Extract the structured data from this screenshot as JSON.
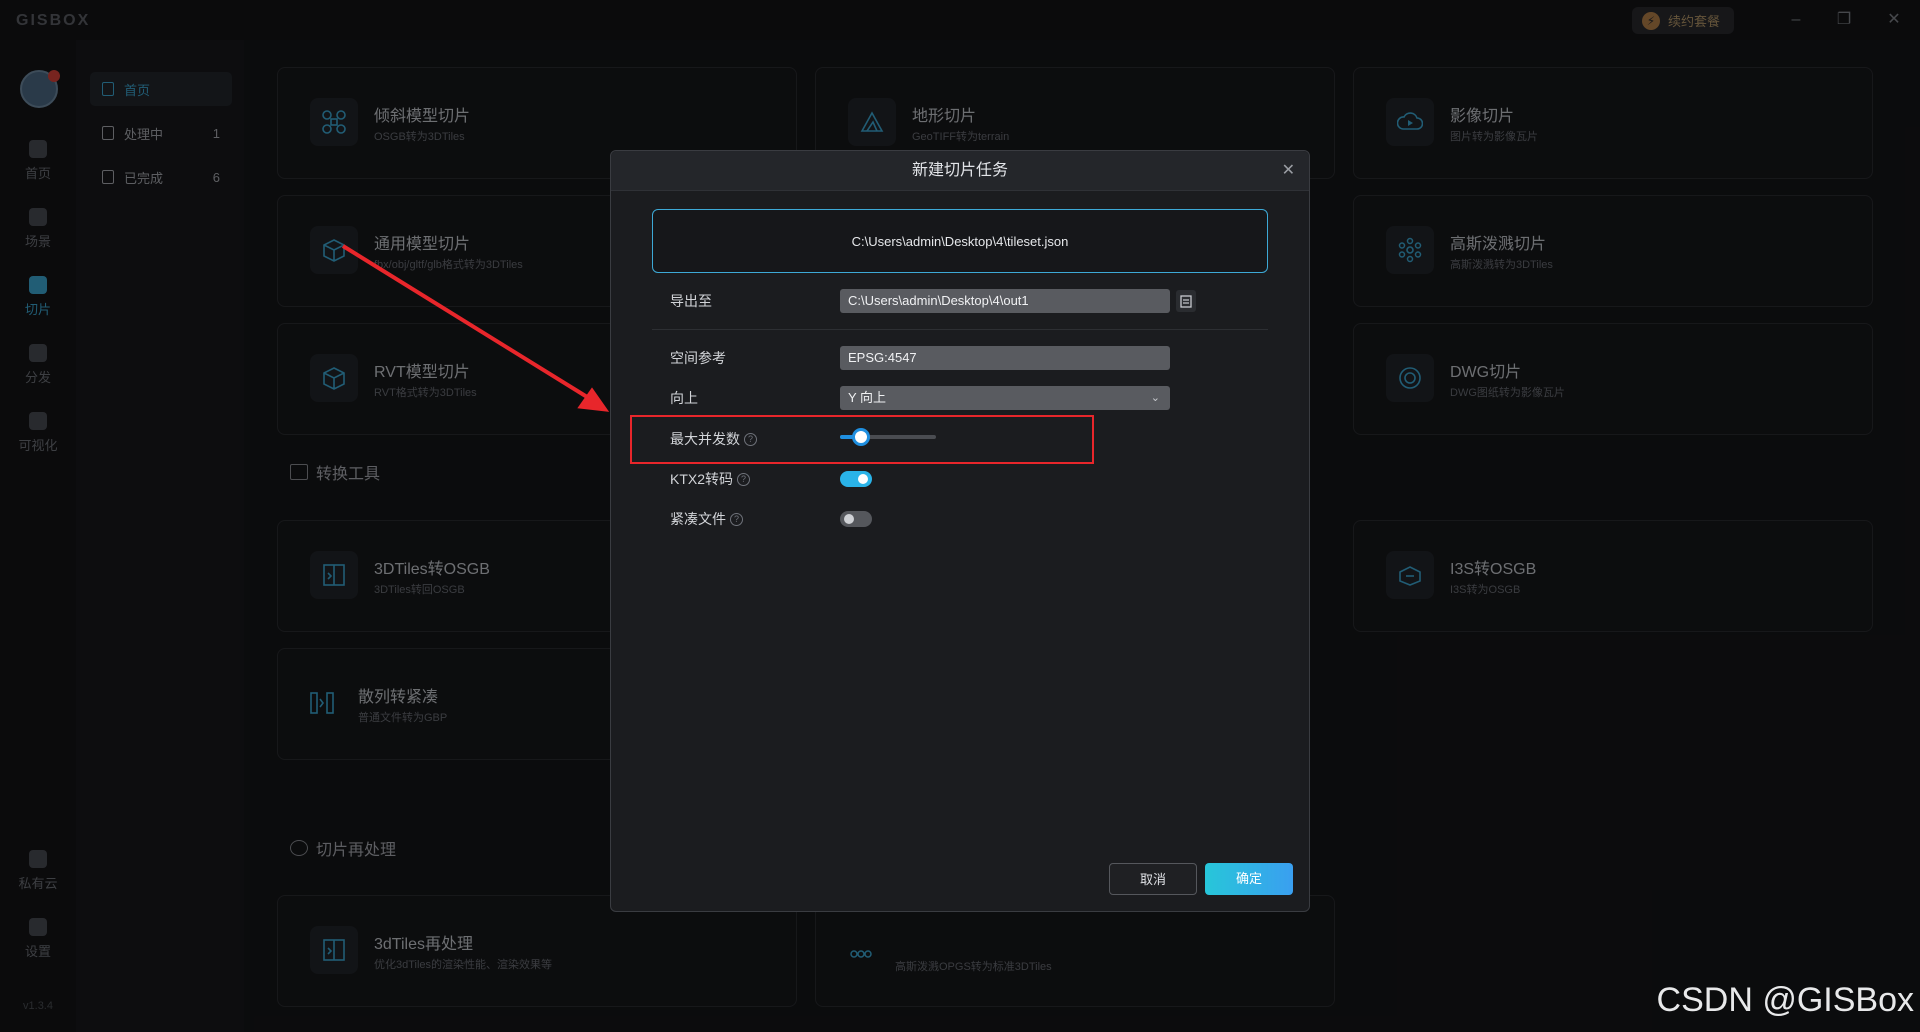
{
  "app": {
    "logo": "GISBOX",
    "renew_label": "续约套餐",
    "window_controls": [
      "minimize-icon",
      "restore-icon",
      "close-icon"
    ]
  },
  "rail": {
    "items": [
      {
        "label": "首页",
        "icon": "home-icon",
        "active": false
      },
      {
        "label": "场景",
        "icon": "scene-icon",
        "active": false
      },
      {
        "label": "切片",
        "icon": "slice-icon",
        "active": true
      },
      {
        "label": "分发",
        "icon": "distribute-icon",
        "active": false
      },
      {
        "label": "可视化",
        "icon": "visualize-icon",
        "active": false
      },
      {
        "label": "私有云",
        "icon": "cloud-icon",
        "active": false
      },
      {
        "label": "设置",
        "icon": "settings-icon",
        "active": false
      }
    ],
    "version": "v1.3.4"
  },
  "subnav": {
    "items": [
      {
        "label": "首页",
        "count": "",
        "active": true
      },
      {
        "label": "处理中",
        "count": "1",
        "active": false
      },
      {
        "label": "已完成",
        "count": "6",
        "active": false
      }
    ]
  },
  "cards": {
    "oblique": {
      "title": "倾斜模型切片",
      "subtitle": "OSGB转为3DTiles"
    },
    "terrain": {
      "title": "地形切片",
      "subtitle": "GeoTIFF转为terrain"
    },
    "imagery": {
      "title": "影像切片",
      "subtitle": "图片转为影像瓦片"
    },
    "generic": {
      "title": "通用模型切片",
      "subtitle": "fbx/obj/gltf/glb格式转为3DTiles"
    },
    "gaussian": {
      "title": "高斯泼溅切片",
      "subtitle": "高斯泼溅转为3DTiles"
    },
    "rvt": {
      "title": "RVT模型切片",
      "subtitle": "RVT格式转为3DTiles"
    },
    "dwg": {
      "title": "DWG切片",
      "subtitle": "DWG图纸转为影像瓦片"
    },
    "tiles_osgb": {
      "title": "3DTiles转OSGB",
      "subtitle": "3DTiles转回OSGB"
    },
    "i3s_osgb": {
      "title": "I3S转OSGB",
      "subtitle": "I3S转为OSGB"
    },
    "scatter": {
      "title": "散列转紧凑",
      "subtitle": "普通文件转为GBP"
    },
    "reprocess": {
      "title": "3dTiles再处理",
      "subtitle": "优化3dTiles的渲染性能、渲染效果等"
    },
    "gaussian_opgs": {
      "subtitle": "高斯泼溅OPGS转为标准3DTiles"
    }
  },
  "sections": {
    "convert_tools": "转换工具",
    "reprocess": "切片再处理"
  },
  "dialog": {
    "title": "新建切片任务",
    "source_file": "C:\\Users\\admin\\Desktop\\4\\tileset.json",
    "export_label": "导出至",
    "export_path": "C:\\Users\\admin\\Desktop\\4\\out1",
    "srs_label": "空间参考",
    "srs_value": "EPSG:4547",
    "up_label": "向上",
    "up_value": "Y 向上",
    "max_concurrency_label": "最大并发数",
    "max_concurrency_fraction": 0.22,
    "ktx2_label": "KTX2转码",
    "ktx2_on": true,
    "compact_label": "紧凑文件",
    "compact_on": false,
    "cancel_label": "取消",
    "ok_label": "确定"
  },
  "watermark": "CSDN @GISBox",
  "colors": {
    "accent": "#3da9d6",
    "annotation_red": "#e8262b",
    "ok_gradient_start": "#27c6d9",
    "ok_gradient_end": "#3a9ff0"
  }
}
